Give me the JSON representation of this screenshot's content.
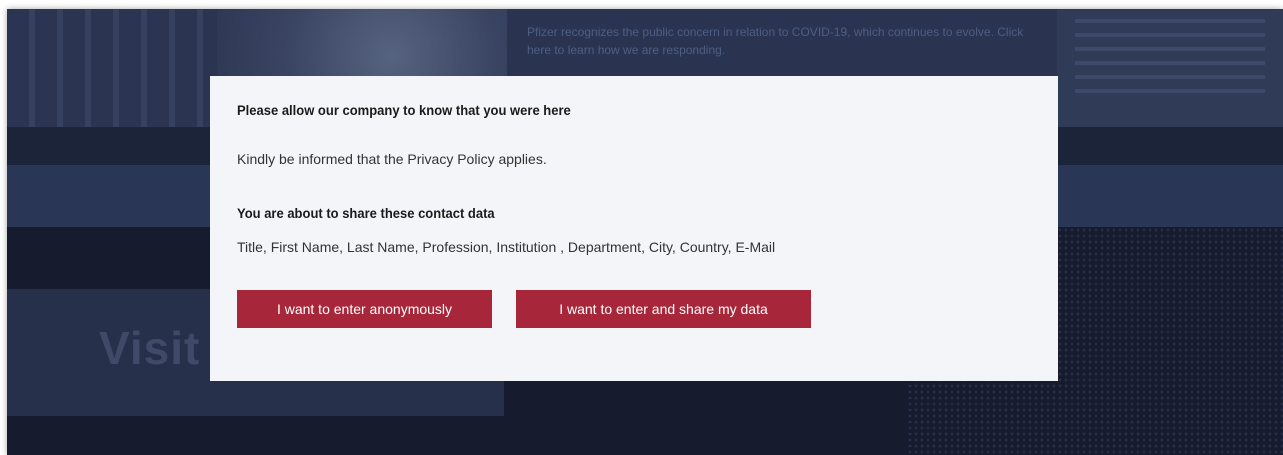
{
  "modal": {
    "heading": "Please allow our company to know that you were here",
    "notice": "Kindly be informed that the Privacy Policy applies.",
    "subheading": "You are about to share these contact data",
    "fields": "Title, First Name, Last Name, Profession, Institution , Department, City, Country, E-Mail",
    "anonymous_button": "I want to enter anonymously",
    "share_button": "I want to enter and share my data"
  },
  "background": {
    "notice_text": "Pfizer recognizes the public concern in relation to COVID-19, which continues to evolve. Click here to learn how we are responding.",
    "card_title": "Visit"
  },
  "colors": {
    "button": "#a8263a",
    "overlay": "#1a2137",
    "modal": "#f4f5f8"
  }
}
